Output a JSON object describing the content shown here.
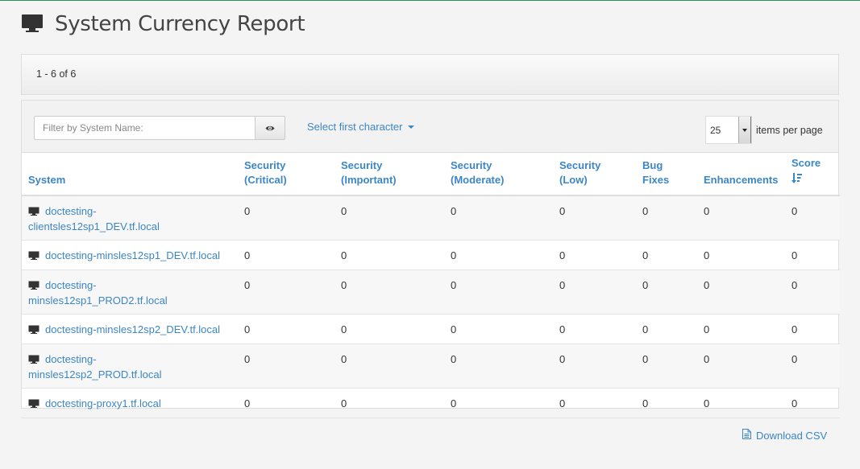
{
  "header": {
    "title": "System Currency Report",
    "icon": "monitor-icon"
  },
  "pager": {
    "range_text": "1 - 6 of 6"
  },
  "toolbar": {
    "filter_placeholder": "Filter by System Name:",
    "filter_value": "",
    "filter_button_icon": "eye-icon",
    "first_char_label": "Select first character",
    "per_page_value": "25",
    "per_page_label": "items per page"
  },
  "table": {
    "columns": {
      "system": "System",
      "sec_critical_1": "Security",
      "sec_critical_2": "(Critical)",
      "sec_important_1": "Security",
      "sec_important_2": "(Important)",
      "sec_moderate_1": "Security",
      "sec_moderate_2": "(Moderate)",
      "sec_low_1": "Security",
      "sec_low_2": "(Low)",
      "bug_1": "Bug",
      "bug_2": "Fixes",
      "enhancements": "Enhancements",
      "score": "Score",
      "score_sort_icon": "sort-descending-icon"
    },
    "rows": [
      {
        "system_1": "doctesting-",
        "system_2": "clientsles12sp1_DEV.tf.local",
        "critical": "0",
        "important": "0",
        "moderate": "0",
        "low": "0",
        "bugs": "0",
        "enhancements": "0",
        "score": "0"
      },
      {
        "system_1": "doctesting-minsles12sp1_DEV.tf.local",
        "system_2": "",
        "critical": "0",
        "important": "0",
        "moderate": "0",
        "low": "0",
        "bugs": "0",
        "enhancements": "0",
        "score": "0"
      },
      {
        "system_1": "doctesting-",
        "system_2": "minsles12sp1_PROD2.tf.local",
        "critical": "0",
        "important": "0",
        "moderate": "0",
        "low": "0",
        "bugs": "0",
        "enhancements": "0",
        "score": "0"
      },
      {
        "system_1": "doctesting-minsles12sp2_DEV.tf.local",
        "system_2": "",
        "critical": "0",
        "important": "0",
        "moderate": "0",
        "low": "0",
        "bugs": "0",
        "enhancements": "0",
        "score": "0"
      },
      {
        "system_1": "doctesting-",
        "system_2": "minsles12sp2_PROD.tf.local",
        "critical": "0",
        "important": "0",
        "moderate": "0",
        "low": "0",
        "bugs": "0",
        "enhancements": "0",
        "score": "0"
      },
      {
        "system_1": "doctesting-proxy1.tf.local",
        "system_2": "",
        "critical": "0",
        "important": "0",
        "moderate": "0",
        "low": "0",
        "bugs": "0",
        "enhancements": "0",
        "score": "0"
      }
    ]
  },
  "footer": {
    "download_label": "Download CSV",
    "download_icon": "csv-file-icon"
  },
  "colors": {
    "link": "#3b86c6",
    "top_border": "#2f8f5b"
  }
}
